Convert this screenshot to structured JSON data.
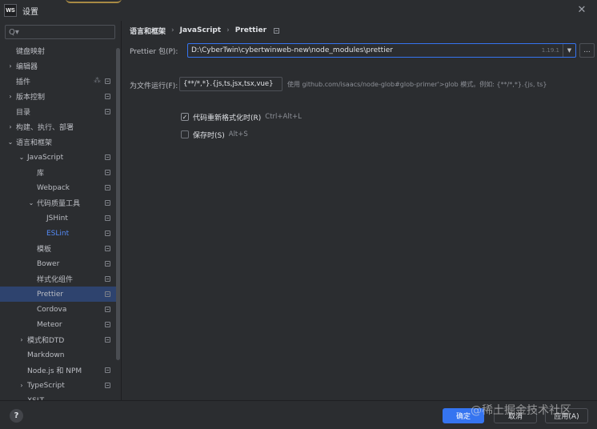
{
  "window": {
    "title": "设置",
    "app_icon": "WS"
  },
  "search": {
    "placeholder": "Q▾"
  },
  "sidebar": {
    "items": [
      {
        "label": "键盘映射",
        "arrow": "",
        "level": 0,
        "badge": false
      },
      {
        "label": "编辑器",
        "arrow": "›",
        "level": 0,
        "badge": false
      },
      {
        "label": "插件",
        "arrow": "",
        "level": 0,
        "badge": true
      },
      {
        "label": "版本控制",
        "arrow": "›",
        "level": 0,
        "badge": true
      },
      {
        "label": "目录",
        "arrow": "",
        "level": 0,
        "badge": true
      },
      {
        "label": "构建、执行、部署",
        "arrow": "›",
        "level": 0,
        "badge": false
      },
      {
        "label": "语言和框架",
        "arrow": "⌄",
        "level": 0,
        "badge": false
      },
      {
        "label": "JavaScript",
        "arrow": "⌄",
        "level": 1,
        "badge": true
      },
      {
        "label": "库",
        "arrow": "",
        "level": 2,
        "badge": true
      },
      {
        "label": "Webpack",
        "arrow": "",
        "level": 2,
        "badge": true
      },
      {
        "label": "代码质量工具",
        "arrow": "⌄",
        "level": 2,
        "badge": true
      },
      {
        "label": "JSHint",
        "arrow": "",
        "level": 3,
        "badge": true
      },
      {
        "label": "ESLint",
        "arrow": "",
        "level": 3,
        "badge": true,
        "link": true
      },
      {
        "label": "模板",
        "arrow": "",
        "level": 2,
        "badge": true
      },
      {
        "label": "Bower",
        "arrow": "",
        "level": 2,
        "badge": true
      },
      {
        "label": "样式化组件",
        "arrow": "",
        "level": 2,
        "badge": true
      },
      {
        "label": "Prettier",
        "arrow": "",
        "level": 2,
        "badge": true,
        "selected": true
      },
      {
        "label": "Cordova",
        "arrow": "",
        "level": 2,
        "badge": true
      },
      {
        "label": "Meteor",
        "arrow": "",
        "level": 2,
        "badge": true
      },
      {
        "label": "模式和DTD",
        "arrow": "›",
        "level": 1,
        "badge": true
      },
      {
        "label": "Markdown",
        "arrow": "",
        "level": 1,
        "badge": false
      },
      {
        "label": "Node.js 和 NPM",
        "arrow": "",
        "level": 1,
        "badge": true
      },
      {
        "label": "TypeScript",
        "arrow": "›",
        "level": 1,
        "badge": true
      },
      {
        "label": "XSLT",
        "arrow": "",
        "level": 1,
        "badge": false
      }
    ]
  },
  "breadcrumb": [
    "语言和框架",
    "JavaScript",
    "Prettier"
  ],
  "prettier_package": {
    "label": "Prettier 包(P):",
    "value": "D:\\CyberTwin\\cybertwinweb-new\\node_modules\\prettier",
    "version": "1.19.1",
    "browse_label": "..."
  },
  "run_for_files": {
    "label": "为文件运行(F):",
    "value": "{**/*,*}.{js,ts,jsx,tsx,vue}",
    "hint": "使用 github.com/isaacs/node-glob#glob-primer'>glob 模式。例如: {**/*,*}.{js, ts}"
  },
  "options": [
    {
      "label": "代码重新格式化时(R)",
      "shortcut": "Ctrl+Alt+L",
      "checked": true
    },
    {
      "label": "保存时(S)",
      "shortcut": "Alt+S",
      "checked": false
    }
  ],
  "footer": {
    "help": "?",
    "ok": "确定",
    "cancel": "取消",
    "apply": "应用(A)"
  },
  "watermark": "@稀土掘金技术社区",
  "colors": {
    "accent": "#3574f0",
    "selected_bg": "#2e436e",
    "link": "#548af7",
    "background": "#2b2d30"
  }
}
